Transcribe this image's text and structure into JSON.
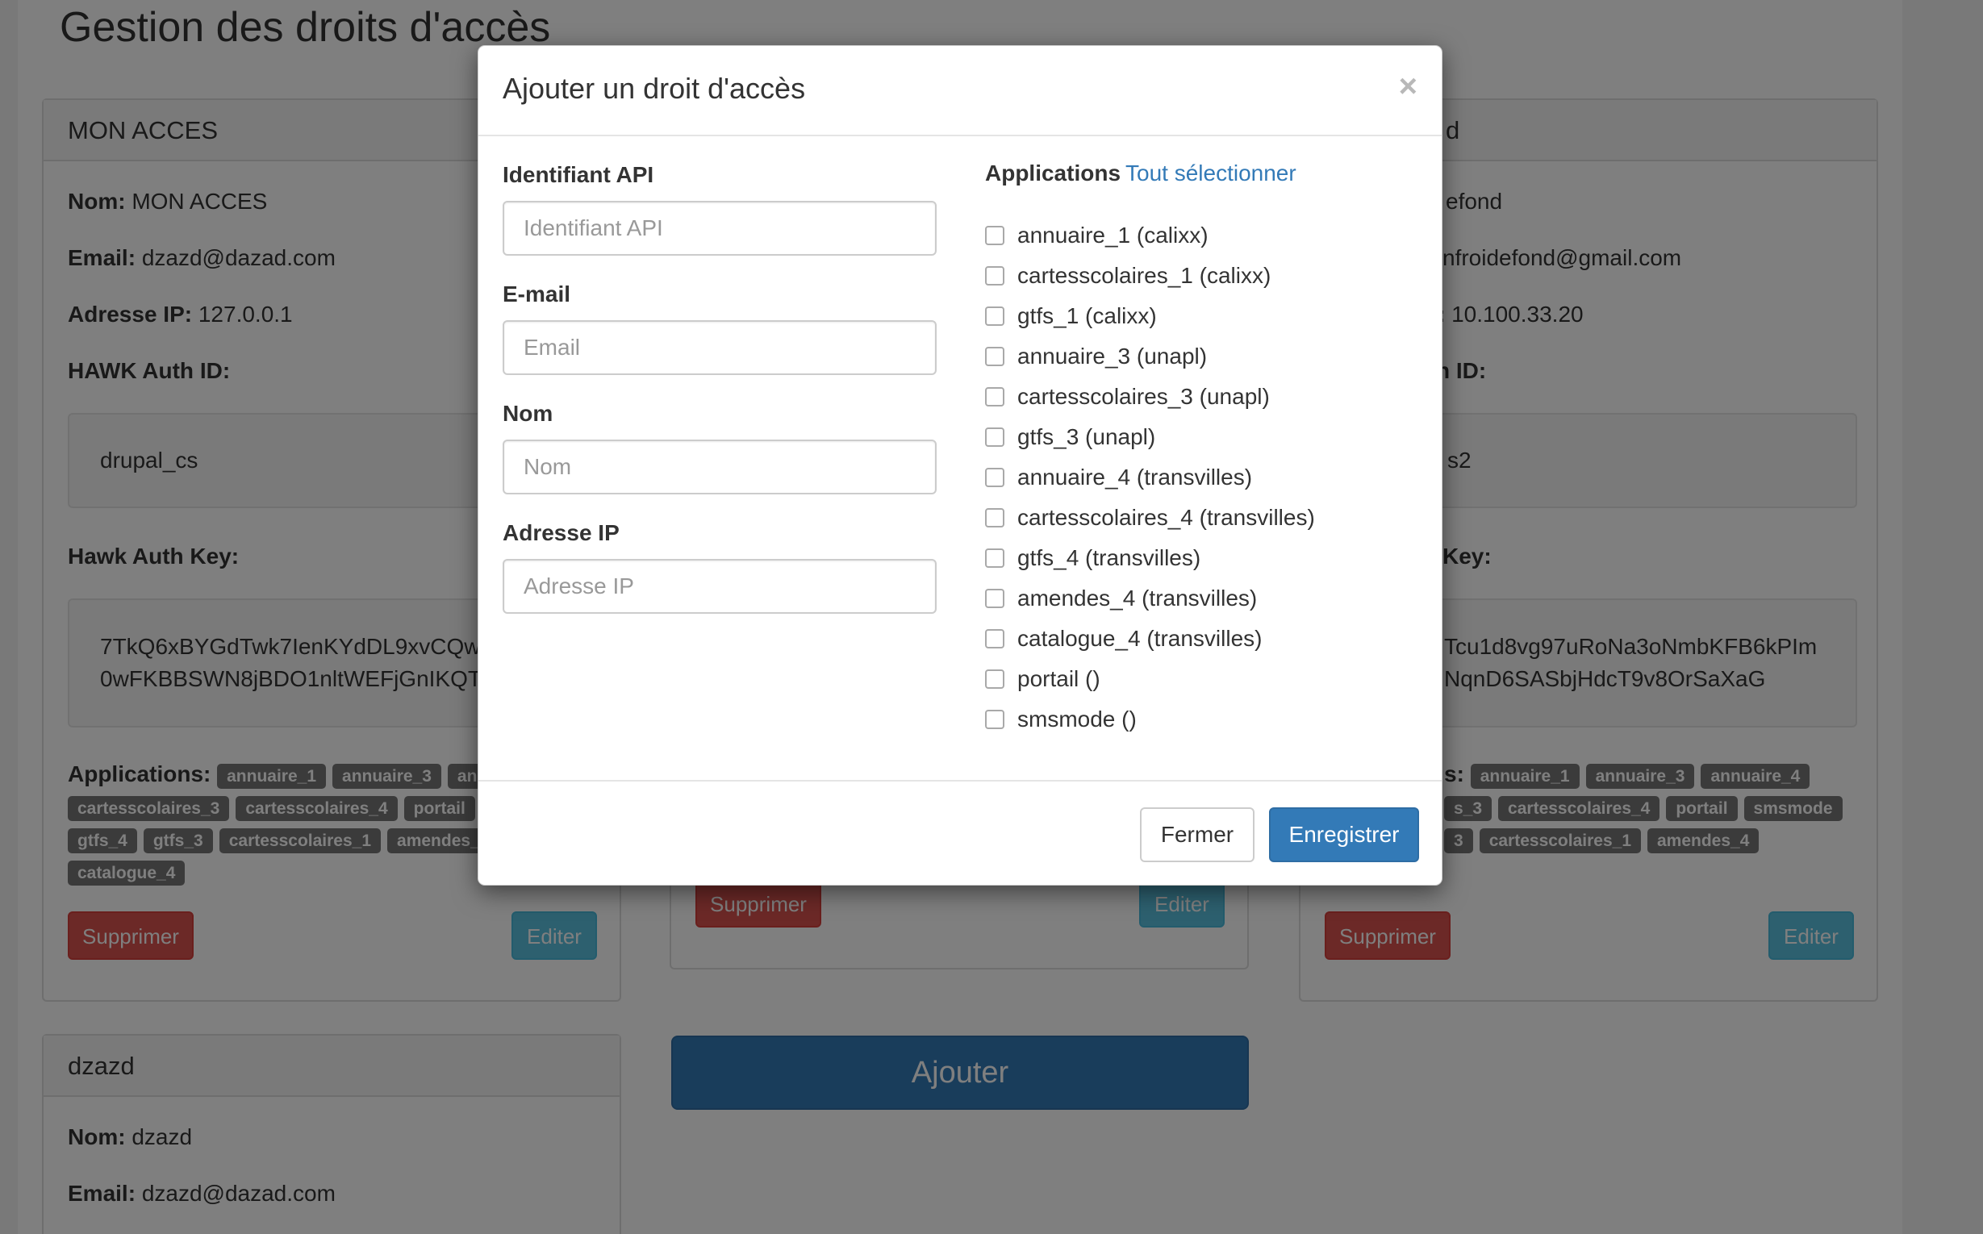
{
  "page": {
    "title": "Gestion des droits d'accès",
    "add_button": "Ajouter"
  },
  "cards": [
    {
      "header": "MON ACCES",
      "nom_label": "Nom:",
      "nom": "MON ACCES",
      "email_label": "Email:",
      "email": "dzazd@dazad.com",
      "ip_label": "Adresse IP:",
      "ip": "127.0.0.1",
      "hawk_id_label": "HAWK Auth ID:",
      "hawk_id": "drupal_cs",
      "hawk_key_label": "Hawk Auth Key:",
      "hawk_key_line1": "7TkQ6xBYGdTwk7IenKYdDL9xvCQw",
      "hawk_key_line2": "0wFKBBSWN8jBDO1nltWEFjGnIKQT",
      "apps_label": "Applications:",
      "badges_row1": [
        "annuaire_1",
        "annuaire_3",
        "anr"
      ],
      "badges_row2": [
        "cartesscolaires_3",
        "cartesscolaires_4",
        "portail"
      ],
      "badges_row3": [
        "gtfs_4",
        "gtfs_3",
        "cartesscolaires_1",
        "amendes_"
      ],
      "badges_row4": [
        "catalogue_4"
      ],
      "delete": "Supprimer",
      "edit": "Editer"
    },
    {
      "delete": "Supprimer",
      "edit": "Editer"
    },
    {
      "header": "d",
      "nom": "efond",
      "email": "nfroidefond@gmail.com",
      "ip_label": ":",
      "ip": "10.100.33.20",
      "hawk_id_label": "n ID:",
      "hawk_id": "s2",
      "hawk_key_label": "Key:",
      "hawk_key_line1": "Tcu1d8vg97uRoNa3oNmbKFB6kPIm",
      "hawk_key_line2": "NqnD6SASbjHdcT9v8OrSaXaG",
      "apps_label": "s:",
      "badges_row1": [
        "annuaire_1",
        "annuaire_3",
        "annuaire_4"
      ],
      "badges_row2": [
        "s_3",
        "cartesscolaires_4",
        "portail",
        "smsmode"
      ],
      "badges_row3": [
        "3",
        "cartesscolaires_1",
        "amendes_4"
      ],
      "delete": "Supprimer",
      "edit": "Editer"
    },
    {
      "header": "dzazd",
      "nom_label": "Nom:",
      "nom": "dzazd",
      "email_label": "Email:",
      "email": "dzazd@dazad.com"
    }
  ],
  "modal": {
    "title": "Ajouter un droit d'accès",
    "close": "×",
    "fields": {
      "api_label": "Identifiant API",
      "api_placeholder": "Identifiant API",
      "email_label": "E-mail",
      "email_placeholder": "Email",
      "nom_label": "Nom",
      "nom_placeholder": "Nom",
      "ip_label": "Adresse IP",
      "ip_placeholder": "Adresse IP"
    },
    "apps_title": "Applications",
    "select_all": "Tout sélectionner",
    "apps": [
      "annuaire_1 (calixx)",
      "cartesscolaires_1 (calixx)",
      "gtfs_1 (calixx)",
      "annuaire_3 (unapl)",
      "cartesscolaires_3 (unapl)",
      "gtfs_3 (unapl)",
      "annuaire_4 (transvilles)",
      "cartesscolaires_4 (transvilles)",
      "gtfs_4 (transvilles)",
      "amendes_4 (transvilles)",
      "catalogue_4 (transvilles)",
      "portail ()",
      "smsmode ()"
    ],
    "close_button": "Fermer",
    "save_button": "Enregistrer"
  }
}
